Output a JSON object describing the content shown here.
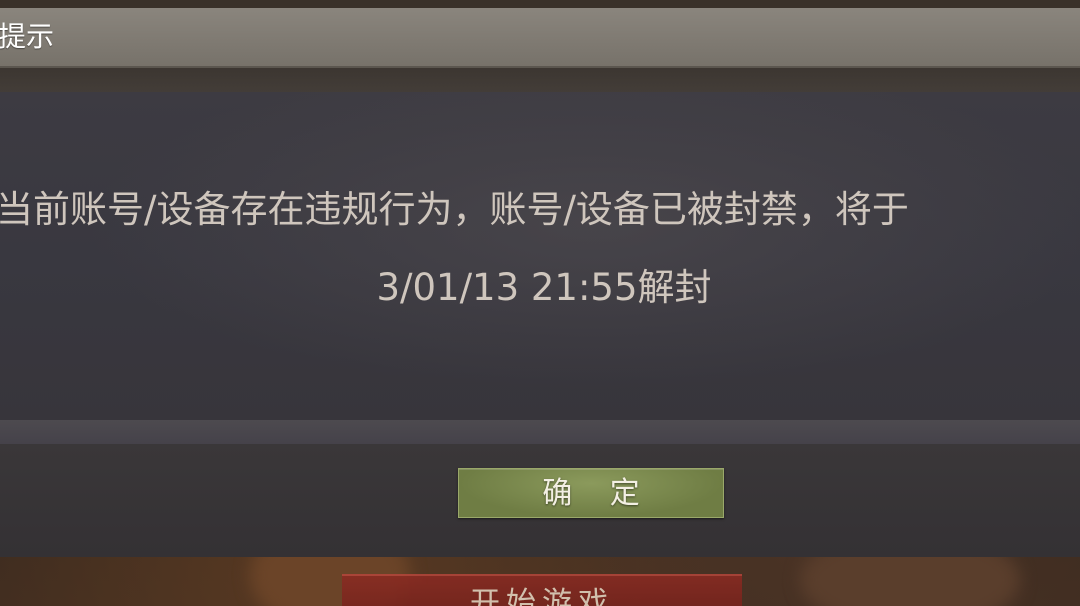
{
  "background": {
    "start_button_label": "开始游戏"
  },
  "dialog": {
    "title": "提示",
    "message_line_1": "当前账号/设备存在违规行为，账号/设备已被封禁，将于",
    "message_line_2": "3/01/13 21:55解封",
    "confirm_label": "确 定"
  },
  "colors": {
    "header": "#7f7a72",
    "body": "#3b3940",
    "confirm_button": "#7a8a4e",
    "text": "#cfc6bd"
  }
}
